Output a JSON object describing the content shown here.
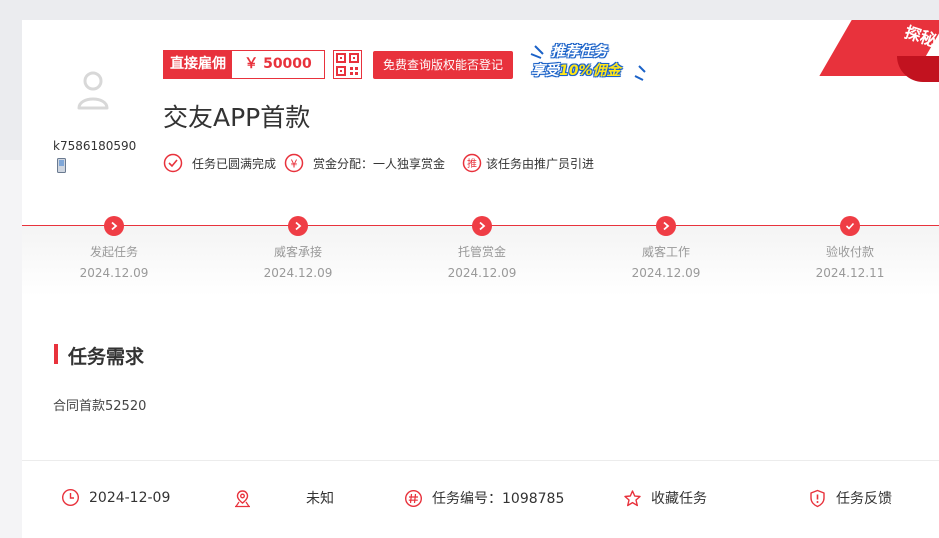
{
  "user": {
    "username": "k7586180590"
  },
  "header": {
    "hire_label": "直接雇佣",
    "amount": "￥ 50000",
    "copyright_button": "免费查询版权能否登记",
    "promo_line1": "推荐任务",
    "promo_line2_a": "享受",
    "promo_line2_b": "10%佣金",
    "ribbon_text": "探秘"
  },
  "task": {
    "title": "交友APP首款",
    "meta": [
      {
        "icon": "check-circle-icon",
        "text": "任务已圆满完成"
      },
      {
        "icon": "yen-circle-icon",
        "text": "赏金分配：一人独享赏金"
      },
      {
        "icon": "promote-circle-icon",
        "text": "该任务由推广员引进"
      }
    ]
  },
  "progress": {
    "steps": [
      {
        "name": "发起任务",
        "date": "2024.12.09",
        "icon": "arrow-right-icon"
      },
      {
        "name": "威客承接",
        "date": "2024.12.09",
        "icon": "arrow-right-icon"
      },
      {
        "name": "托管赏金",
        "date": "2024.12.09",
        "icon": "arrow-right-icon"
      },
      {
        "name": "威客工作",
        "date": "2024.12.09",
        "icon": "arrow-right-icon"
      },
      {
        "name": "验收付款",
        "date": "2024.12.11",
        "icon": "check-icon"
      }
    ]
  },
  "requirements": {
    "title": "任务需求",
    "text": "合同首款52520"
  },
  "footer": {
    "date": "2024-12-09",
    "location": "未知",
    "task_number": "任务编号：1098785",
    "favorite": "收藏任务",
    "feedback": "任务反馈"
  },
  "colors": {
    "accent": "#e8323c",
    "muted": "#999999"
  }
}
